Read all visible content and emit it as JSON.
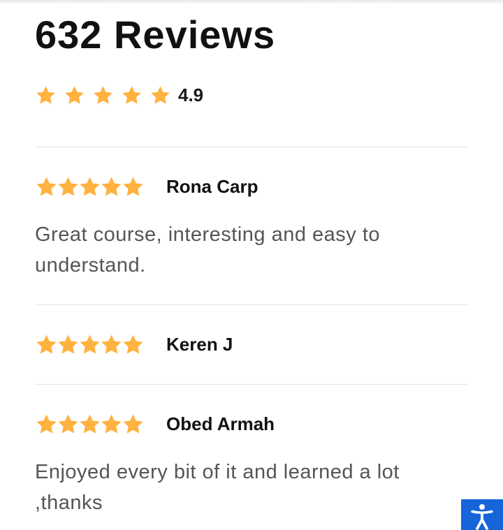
{
  "header": {
    "title": "632 Reviews",
    "average_rating": "4.9",
    "stars": 5
  },
  "reviews": [
    {
      "reviewer": "Rona Carp",
      "stars": 5,
      "text": "Great course, interesting and easy to understand."
    },
    {
      "reviewer": "Keren J",
      "stars": 5,
      "text": ""
    },
    {
      "reviewer": "Obed Armah",
      "stars": 5,
      "text": "Enjoyed every bit of it and learned a lot ,thanks"
    }
  ],
  "colors": {
    "star": "#FFB23F",
    "accessibility_button": "#1565D8"
  },
  "icons": {
    "rating": "star-icon",
    "accessibility": "accessibility-icon"
  }
}
